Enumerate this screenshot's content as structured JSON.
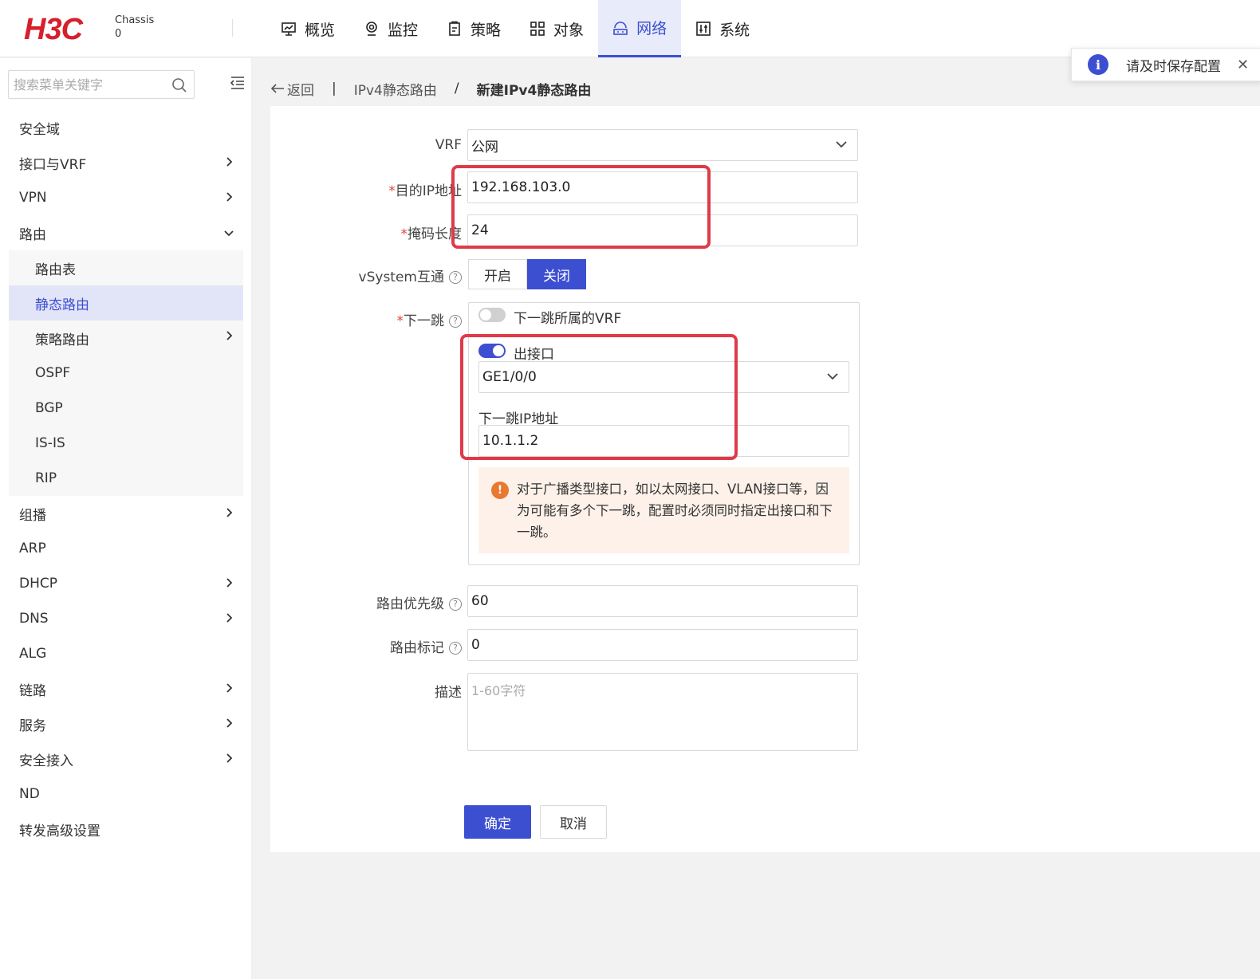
{
  "header": {
    "logo": "H3C",
    "chassis_label": "Chassis",
    "chassis_value": "0",
    "nav": [
      {
        "label": "概览",
        "icon": "monitor-icon"
      },
      {
        "label": "监控",
        "icon": "camera-icon"
      },
      {
        "label": "策略",
        "icon": "clipboard-icon"
      },
      {
        "label": "对象",
        "icon": "grid-icon"
      },
      {
        "label": "网络",
        "icon": "network-icon",
        "active": true
      },
      {
        "label": "系统",
        "icon": "system-icon"
      }
    ]
  },
  "toast": {
    "text": "请及时保存配置"
  },
  "sidebar": {
    "search_placeholder": "搜索菜单关键字",
    "items": [
      {
        "label": "安全域"
      },
      {
        "label": "接口与VRF",
        "chevron": "right"
      },
      {
        "label": "VPN",
        "chevron": "right"
      },
      {
        "label": "路由",
        "chevron": "down"
      },
      {
        "label": "组播",
        "chevron": "right"
      },
      {
        "label": "ARP"
      },
      {
        "label": "DHCP",
        "chevron": "right"
      },
      {
        "label": "DNS",
        "chevron": "right"
      },
      {
        "label": "ALG"
      },
      {
        "label": "链路",
        "chevron": "right"
      },
      {
        "label": "服务",
        "chevron": "right"
      },
      {
        "label": "安全接入",
        "chevron": "right"
      },
      {
        "label": "ND"
      },
      {
        "label": "转发高级设置"
      }
    ],
    "routing_sub": [
      {
        "label": "路由表"
      },
      {
        "label": "静态路由",
        "active": true
      },
      {
        "label": "策略路由",
        "chevron": "right"
      },
      {
        "label": "OSPF"
      },
      {
        "label": "BGP"
      },
      {
        "label": "IS-IS"
      },
      {
        "label": "RIP"
      }
    ]
  },
  "breadcrumb": {
    "back": "返回",
    "parent": "IPv4静态路由",
    "separator": "/",
    "current": "新建IPv4静态路由"
  },
  "form": {
    "vrf_label": "VRF",
    "vrf_value": "公网",
    "dest_ip_label": "目的IP地址",
    "dest_ip_value": "192.168.103.0",
    "mask_label": "掩码长度",
    "mask_value": "24",
    "vsystem_label": "vSystem互通",
    "vsystem_on": "开启",
    "vsystem_off": "关闭",
    "vsystem_selected": "关闭",
    "nexthop_label": "下一跳",
    "nexthop_vrf_toggle_label": "下一跳所属的VRF",
    "nexthop_vrf_enabled": false,
    "out_if_toggle_label": "出接口",
    "out_if_enabled": true,
    "out_if_value": "GE1/0/0",
    "nexthop_ip_label": "下一跳IP地址",
    "nexthop_ip_value": "10.1.1.2",
    "warning": "对于广播类型接口，如以太网接口、VLAN接口等，因为可能有多个下一跳，配置时必须同时指定出接口和下一跳。",
    "priority_label": "路由优先级",
    "priority_value": "60",
    "tag_label": "路由标记",
    "tag_value": "0",
    "desc_label": "描述",
    "desc_placeholder": "1-60字符",
    "ok_label": "确定",
    "cancel_label": "取消"
  },
  "colors": {
    "accent": "#3d4fd1",
    "brand": "#d6202b",
    "highlight": "#e03a4a",
    "warning": "#e8792f"
  }
}
